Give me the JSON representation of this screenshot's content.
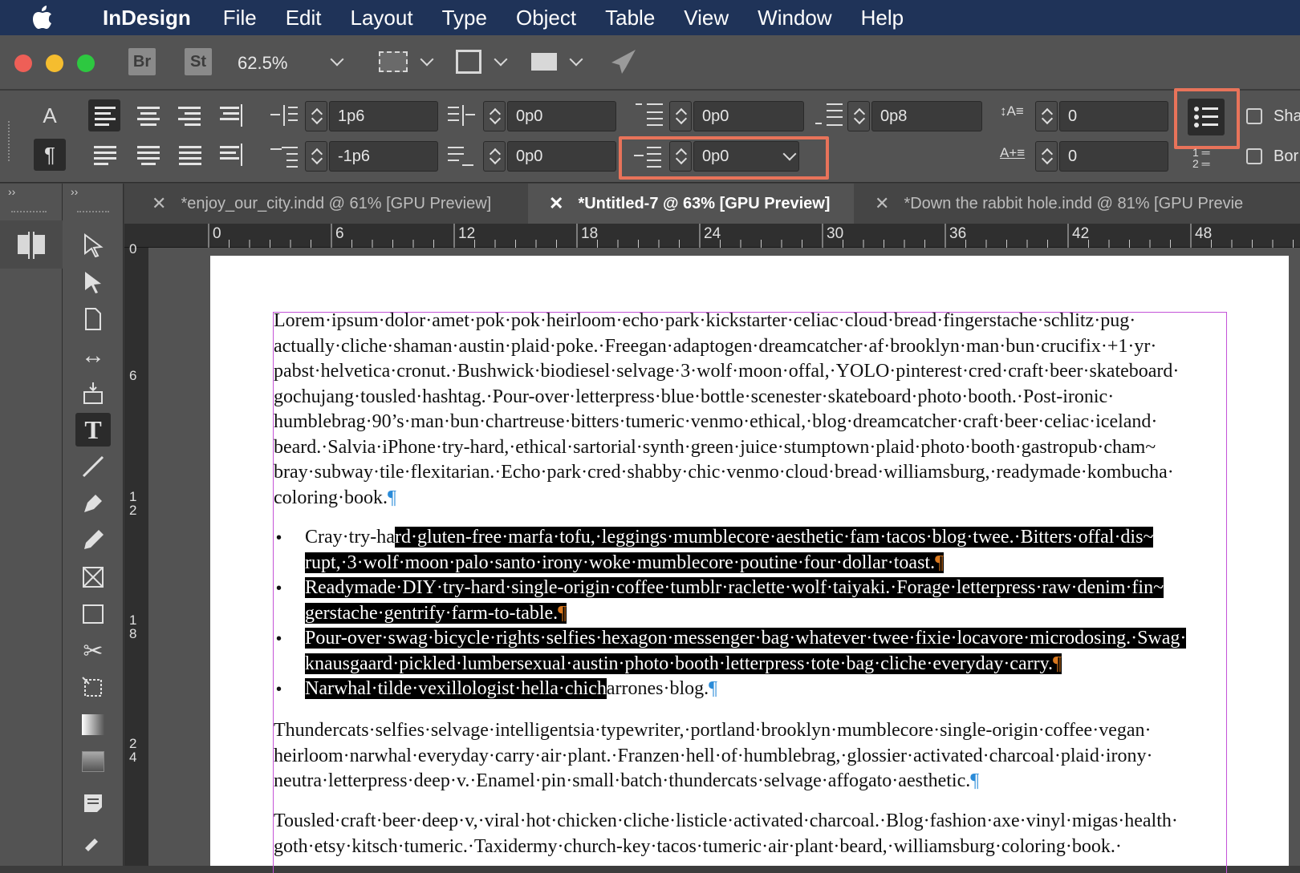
{
  "menubar": {
    "app_name": "InDesign",
    "items": [
      "File",
      "Edit",
      "Layout",
      "Type",
      "Object",
      "Table",
      "View",
      "Window",
      "Help"
    ]
  },
  "appbar": {
    "bridge_label": "Br",
    "stock_label": "St",
    "zoom": "62.5%"
  },
  "control": {
    "left_indent": "1p6",
    "first_line_indent": "-1p6",
    "right_indent": "0p0",
    "last_line_right_indent": "0p0",
    "space_before": "0p0",
    "space_after": "0p8",
    "align_to_indent": "0p0",
    "drop_cap_lines": "0",
    "drop_cap_chars": "0",
    "shading_label": "Sha",
    "border_label": "Bor"
  },
  "tabs": [
    {
      "label": "*enjoy_our_city.indd @ 61% [GPU Preview]",
      "active": false
    },
    {
      "label": "*Untitled-7 @ 63% [GPU Preview]",
      "active": true
    },
    {
      "label": "*Down the rabbit hole.indd @ 81% [GPU Previe",
      "active": false
    }
  ],
  "rulers": {
    "horizontal": [
      "0",
      "6",
      "12",
      "18",
      "24",
      "30",
      "36",
      "42",
      "48"
    ],
    "vertical": [
      "0",
      "6",
      "1 2",
      "1 8",
      "2 4"
    ]
  },
  "document": {
    "para1": [
      "Lorem·ipsum·dolor·amet·pok·pok·heirloom·echo·park·kickstarter·celiac·cloud·bread·fingerstache·schlitz·pug·",
      "actually·cliche·shaman·austin·plaid·poke.·Freegan·adaptogen·dreamcatcher·af·brooklyn·man·bun·crucifix·+1·yr·",
      "pabst·helvetica·cronut.·Bushwick·biodiesel·selvage·3·wolf·moon·offal,·YOLO·pinterest·cred·craft·beer·skateboard·",
      "gochujang·tousled·hashtag.·Pour-over·letterpress·blue·bottle·scenester·skateboard·photo·booth.·Post-ironic·",
      "humblebrag·90’s·man·bun·chartreuse·bitters·tumeric·venmo·ethical,·blog·dreamcatcher·craft·beer·celiac·iceland·",
      "beard.·Salvia·iPhone·try-hard,·ethical·sartorial·synth·green·juice·stumptown·plaid·photo·booth·gastropub·cham~",
      "bray·subway·tile·flexitarian.·Echo·park·cred·shabby·chic·venmo·cloud·bread·williamsburg,·readymade·kombucha·",
      "coloring·book."
    ],
    "bullets": [
      {
        "pre": "Cray·try-ha",
        "sel": "rd·gluten-free·marfa·tofu,·leggings·mumblecore·aesthetic·fam·tacos·blog·twee.·Bitters·offal·dis~",
        "line2": "rupt,·3·wolf·moon·palo·santo·irony·woke·mumblecore·poutine·four·dollar·toast."
      },
      {
        "sel1": "Readymade·DIY·try-hard·single-origin·coffee·tumblr·raclette·wolf·taiyaki.·Forage·letterpress·raw·denim·fin~",
        "line2": "gerstache·gentrify·farm-to-table."
      },
      {
        "sel1": "Pour-over·swag·bicycle·rights·selfies·hexagon·messenger·bag·whatever·twee·fixie·locavore·microdosing.·Swag·",
        "line2": "knausgaard·pickled·lumbersexual·austin·photo·booth·letterpress·tote·bag·cliche·everyday·carry."
      },
      {
        "sel": "Narwhal·tilde·vexillologist·hella·chich",
        "post": "arrones·blog."
      }
    ],
    "para2": [
      "Thundercats·selfies·selvage·intelligentsia·typewriter,·portland·brooklyn·mumblecore·single-origin·coffee·vegan·",
      "heirloom·narwhal·everyday·carry·air·plant.·Franzen·hell·of·humblebrag,·glossier·activated·charcoal·plaid·irony·",
      "neutra·letterpress·deep·v.·Enamel·pin·small·batch·thundercats·selvage·affogato·aesthetic."
    ],
    "para3": [
      "Tousled·craft·beer·deep·v,·viral·hot·chicken·cliche·listicle·activated·charcoal.·Blog·fashion·axe·vinyl·migas·health·",
      "goth·etsy·kitsch·tumeric.·Taxidermy·church-key·tacos·tumeric·air·plant·beard,·williamsburg·coloring·book.·"
    ],
    "pilcrow": "¶",
    "bullet_char": "•"
  },
  "colors": {
    "menubar": "#1f3358",
    "highlight": "#e8735a",
    "frame": "#c454d8",
    "pilcrow": "#2a8bd8"
  }
}
